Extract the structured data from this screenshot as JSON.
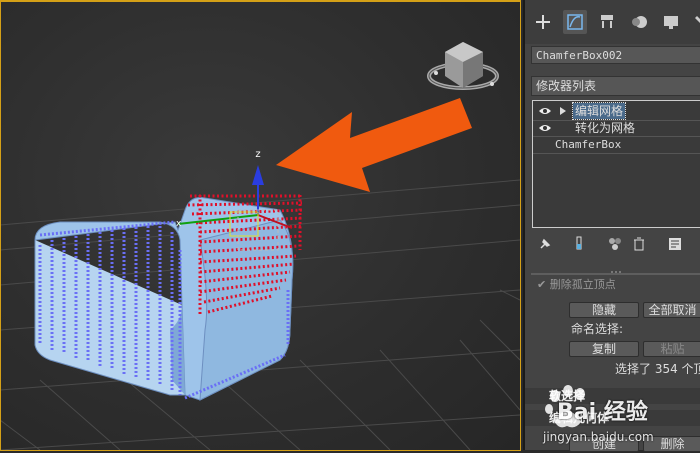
{
  "viewport": {
    "arrow_color": "#f05a0f",
    "gizmo_axis_label": "z"
  },
  "panel": {
    "tabs": [
      "create-icon",
      "modify-icon",
      "hierarchy-icon",
      "motion-icon",
      "display-icon",
      "utilities-icon"
    ],
    "object_name": "ChamferBox002",
    "modifier_list_label": "修改器列表",
    "stack": [
      {
        "label": "编辑网格",
        "has_eye": true,
        "has_arrow": true,
        "selected": true
      },
      {
        "label": "转化为网格",
        "has_eye": true,
        "has_arrow": false,
        "selected": false
      },
      {
        "label": "ChamferBox",
        "has_eye": false,
        "has_arrow": false,
        "selected": false
      }
    ],
    "stack_tools": [
      "pin-stack-icon",
      "show-end-result-icon",
      "make-unique-icon",
      "remove-modifier-icon",
      "configure-modifier-sets-icon"
    ],
    "top_checkbox_label": "删除孤立顶点",
    "hide_button": "隐藏",
    "unhide_all_button": "全部取消隐",
    "named_selection_label": "命名选择:",
    "copy_button": "复制",
    "paste_button": "粘贴",
    "selection_status": "选择了 354 个顶",
    "soft_selection_header": "软选择",
    "edit_geometry_header": "编辑几何体",
    "create_button": "创建",
    "delete_button": "删除"
  },
  "watermark": {
    "brand": "Bai 经验",
    "url": "jingyan.baidu.com"
  }
}
